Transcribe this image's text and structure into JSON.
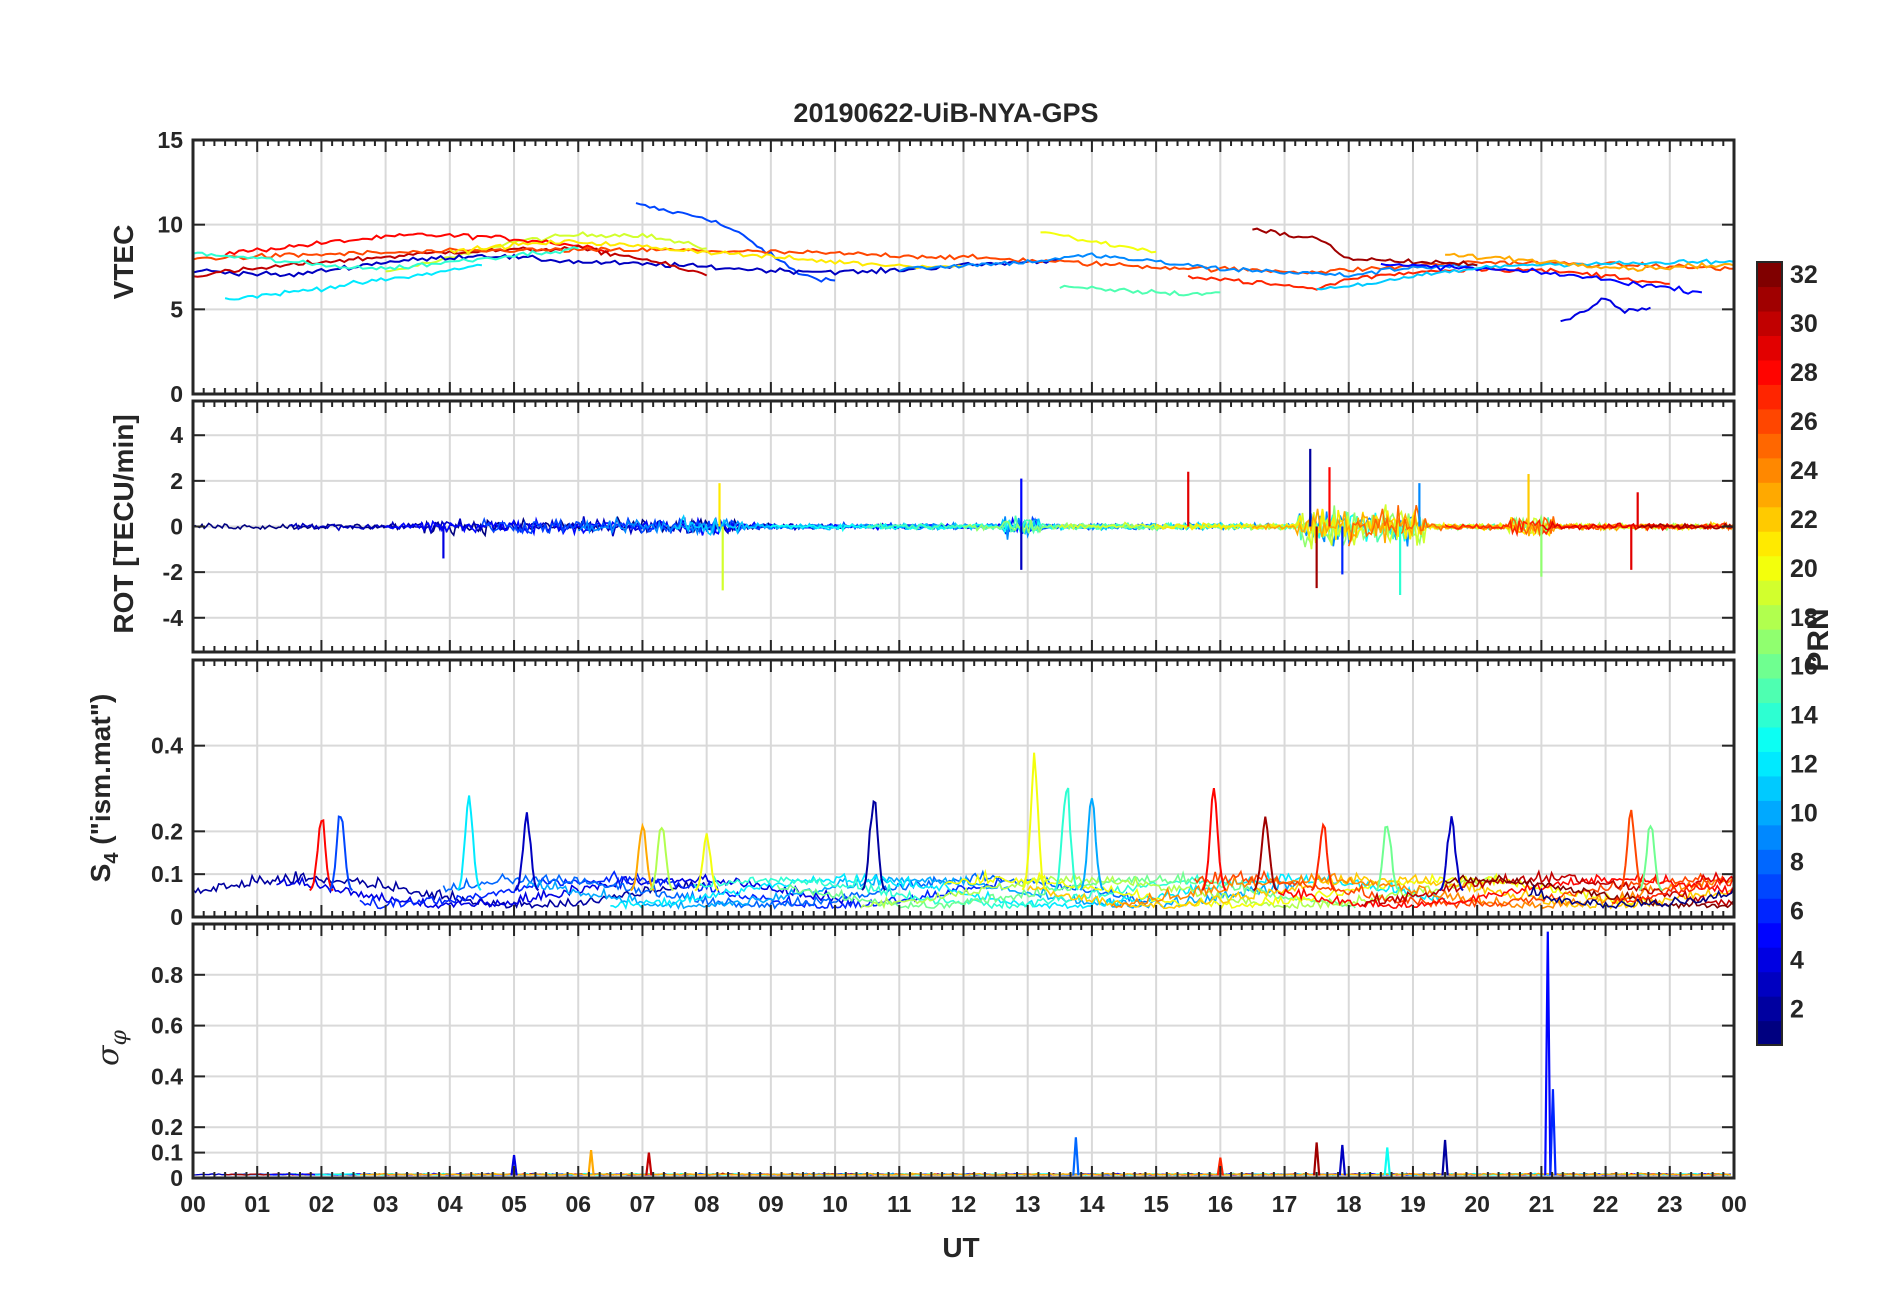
{
  "figure": {
    "title": "20190622-UiB-NYA-GPS",
    "colors": {
      "frame": "#262626",
      "grid": "#d9d9d9",
      "background": "#ffffff"
    }
  },
  "chart_data": [
    {
      "type": "line",
      "panel": "vtec",
      "ylabel": "VTEC",
      "ylim": [
        0,
        15
      ],
      "yticks": [
        0,
        5,
        10,
        15
      ],
      "xlim": [
        0,
        24
      ],
      "xlabel": "",
      "grid": true,
      "series": [
        {
          "prn": 7,
          "x": [
            6.9,
            7.4,
            8.0,
            8.5,
            9.0,
            9.5,
            10.0
          ],
          "y": [
            11.2,
            10.8,
            10.4,
            9.5,
            8.2,
            7.0,
            6.7
          ]
        },
        {
          "prn": 19,
          "x": [
            3.0,
            4.0,
            5.0,
            6.0,
            7.0,
            8.0
          ],
          "y": [
            7.2,
            8.0,
            9.0,
            9.4,
            9.4,
            8.6
          ]
        },
        {
          "prn": 28,
          "x": [
            0.5,
            1.5,
            2.5,
            3.5,
            4.5,
            5.5,
            6.5
          ],
          "y": [
            8.3,
            8.7,
            9.1,
            9.4,
            9.3,
            9.0,
            8.5
          ]
        },
        {
          "prn": 12,
          "x": [
            0.5,
            1.5,
            2.5,
            3.5,
            4.5
          ],
          "y": [
            5.6,
            6.0,
            6.5,
            7.0,
            7.6
          ]
        },
        {
          "prn": 3,
          "x": [
            0.0,
            1.5,
            3.0,
            4.5,
            6.0,
            7.5,
            9.0,
            10.5,
            12.0,
            13.5
          ],
          "y": [
            7.3,
            7.0,
            7.8,
            8.2,
            7.8,
            7.6,
            7.3,
            7.2,
            7.6,
            7.9
          ]
        },
        {
          "prn": 30,
          "x": [
            0.0,
            2.0,
            4.0,
            6.0,
            7.0,
            8.0
          ],
          "y": [
            7.0,
            7.8,
            8.4,
            8.6,
            8.0,
            7.0
          ]
        },
        {
          "prn": 26,
          "x": [
            0.0,
            2.5,
            5.0,
            7.5,
            10.0,
            12.5,
            15.0,
            17.5,
            20.0,
            22.5,
            24.0
          ],
          "y": [
            8.0,
            8.3,
            8.5,
            8.5,
            8.3,
            8.0,
            7.5,
            7.2,
            7.8,
            7.6,
            7.4
          ]
        },
        {
          "prn": 14,
          "x": [
            0.0,
            1.0,
            2.0,
            3.0,
            4.0,
            5.0,
            6.0
          ],
          "y": [
            8.3,
            8.0,
            7.6,
            7.4,
            7.8,
            8.2,
            8.6
          ]
        },
        {
          "prn": 21,
          "x": [
            4.0,
            5.0,
            6.0,
            7.0,
            8.0,
            9.0,
            10.0,
            11.0,
            12.0
          ],
          "y": [
            8.4,
            8.8,
            9.0,
            8.7,
            8.4,
            8.1,
            7.8,
            7.6,
            7.5
          ]
        },
        {
          "prn": 9,
          "x": [
            11.0,
            12.0,
            13.0,
            14.0,
            15.0,
            16.0,
            17.0,
            18.0,
            19.0,
            20.0
          ],
          "y": [
            7.4,
            7.6,
            7.8,
            8.2,
            7.8,
            7.4,
            7.2,
            7.0,
            7.5,
            7.6
          ]
        },
        {
          "prn": 15,
          "x": [
            13.5,
            14.5,
            15.5,
            16.0
          ],
          "y": [
            6.3,
            6.1,
            5.9,
            6.0
          ]
        },
        {
          "prn": 20,
          "x": [
            13.2,
            14.0,
            15.0
          ],
          "y": [
            9.6,
            9.0,
            8.4
          ]
        },
        {
          "prn": 31,
          "x": [
            16.5,
            17.0,
            17.5,
            18.0,
            19.0,
            20.0
          ],
          "y": [
            9.8,
            9.4,
            9.2,
            8.0,
            7.8,
            7.6
          ]
        },
        {
          "prn": 27,
          "x": [
            15.5,
            16.5,
            17.5,
            18.0,
            19.0,
            20.0,
            21.0,
            22.0,
            23.0
          ],
          "y": [
            7.0,
            6.6,
            6.2,
            6.8,
            7.2,
            7.4,
            7.3,
            7.0,
            6.5
          ]
        },
        {
          "prn": 5,
          "x": [
            18.5,
            19.5,
            20.5,
            21.5,
            22.5,
            23.5
          ],
          "y": [
            7.6,
            7.5,
            7.3,
            7.0,
            6.5,
            6.0
          ]
        },
        {
          "prn": 4,
          "x": [
            21.3,
            21.6,
            22.0,
            22.3,
            22.7
          ],
          "y": [
            4.3,
            4.8,
            5.6,
            4.9,
            5.1
          ]
        },
        {
          "prn": 11,
          "x": [
            17.5,
            18.5,
            19.5,
            20.5,
            21.5,
            22.5,
            23.5,
            24.0
          ],
          "y": [
            6.2,
            6.6,
            7.2,
            7.6,
            7.7,
            7.7,
            7.8,
            7.8
          ]
        },
        {
          "prn": 23,
          "x": [
            19.5,
            20.5,
            21.5,
            22.5,
            23.5,
            24.0
          ],
          "y": [
            8.2,
            8.0,
            7.7,
            7.4,
            7.6,
            7.6
          ]
        }
      ]
    },
    {
      "type": "line",
      "panel": "rot",
      "ylabel": "ROT [TECU/min]",
      "ylim": [
        -5.5,
        5.5
      ],
      "yticks": [
        -4,
        -2,
        0,
        2,
        4
      ],
      "xlim": [
        0,
        24
      ],
      "grid": true,
      "spikes": [
        {
          "x": 8.25,
          "y": -2.8,
          "prn": 19
        },
        {
          "x": 8.2,
          "y": 1.9,
          "prn": 21
        },
        {
          "x": 12.9,
          "y": 2.1,
          "prn": 5
        },
        {
          "x": 12.9,
          "y": -1.9,
          "prn": 3
        },
        {
          "x": 15.5,
          "y": 2.4,
          "prn": 29
        },
        {
          "x": 17.4,
          "y": 3.4,
          "prn": 2
        },
        {
          "x": 17.5,
          "y": -2.7,
          "prn": 31
        },
        {
          "x": 17.7,
          "y": 2.6,
          "prn": 28
        },
        {
          "x": 17.9,
          "y": -2.1,
          "prn": 6
        },
        {
          "x": 18.8,
          "y": -3.0,
          "prn": 14
        },
        {
          "x": 19.1,
          "y": 1.9,
          "prn": 9
        },
        {
          "x": 20.8,
          "y": 2.3,
          "prn": 22
        },
        {
          "x": 21.0,
          "y": -2.2,
          "prn": 17
        },
        {
          "x": 22.4,
          "y": -1.9,
          "prn": 29
        },
        {
          "x": 22.5,
          "y": 1.5,
          "prn": 29
        },
        {
          "x": 3.9,
          "y": -1.4,
          "prn": 4
        }
      ]
    },
    {
      "type": "line",
      "panel": "s4",
      "ylabel": "S4 (\"ism.mat\")",
      "ylabel_main": "S",
      "ylabel_sub": "4",
      "ylabel_tail": " (\"ism.mat\")",
      "ylim": [
        0,
        0.6
      ],
      "yticks": [
        0,
        0.1,
        0.2,
        0.4
      ],
      "ytick_labels": [
        "0",
        "0.1",
        "0.2",
        "0.4"
      ],
      "xlim": [
        0,
        24
      ],
      "grid": true,
      "peaks": [
        {
          "x": 2.0,
          "y": 0.25,
          "prn": 28
        },
        {
          "x": 2.3,
          "y": 0.27,
          "prn": 7
        },
        {
          "x": 4.3,
          "y": 0.31,
          "prn": 12
        },
        {
          "x": 5.2,
          "y": 0.25,
          "prn": 3
        },
        {
          "x": 7.0,
          "y": 0.24,
          "prn": 23
        },
        {
          "x": 7.3,
          "y": 0.24,
          "prn": 18
        },
        {
          "x": 8.0,
          "y": 0.21,
          "prn": 20
        },
        {
          "x": 10.6,
          "y": 0.3,
          "prn": 2
        },
        {
          "x": 13.1,
          "y": 0.39,
          "prn": 20
        },
        {
          "x": 13.6,
          "y": 0.34,
          "prn": 14
        },
        {
          "x": 14.0,
          "y": 0.3,
          "prn": 10
        },
        {
          "x": 15.9,
          "y": 0.32,
          "prn": 28
        },
        {
          "x": 16.7,
          "y": 0.25,
          "prn": 31
        },
        {
          "x": 18.6,
          "y": 0.24,
          "prn": 16
        },
        {
          "x": 19.6,
          "y": 0.25,
          "prn": 3
        },
        {
          "x": 22.4,
          "y": 0.26,
          "prn": 26
        },
        {
          "x": 22.7,
          "y": 0.24,
          "prn": 16
        },
        {
          "x": 17.6,
          "y": 0.23,
          "prn": 27
        }
      ]
    },
    {
      "type": "line",
      "panel": "sigma",
      "ylabel": "σφ",
      "ylabel_main": "σ",
      "ylabel_sub": "φ",
      "ylim": [
        0,
        1.0
      ],
      "yticks": [
        0,
        0.1,
        0.2,
        0.4,
        0.6,
        0.8
      ],
      "ytick_labels": [
        "0",
        "0.1",
        "0.2",
        "0.4",
        "0.6",
        "0.8"
      ],
      "xlim": [
        0,
        24
      ],
      "xlabel": "UT",
      "xticks": [
        0,
        1,
        2,
        3,
        4,
        5,
        6,
        7,
        8,
        9,
        10,
        11,
        12,
        13,
        14,
        15,
        16,
        17,
        18,
        19,
        20,
        21,
        22,
        23,
        24
      ],
      "xtick_labels": [
        "00",
        "01",
        "02",
        "03",
        "04",
        "05",
        "06",
        "07",
        "08",
        "09",
        "10",
        "11",
        "12",
        "13",
        "14",
        "15",
        "16",
        "17",
        "18",
        "19",
        "20",
        "21",
        "22",
        "23",
        "00"
      ],
      "grid": true,
      "peaks": [
        {
          "x": 21.1,
          "y": 0.97,
          "prn": 5
        },
        {
          "x": 21.18,
          "y": 0.35,
          "prn": 6
        },
        {
          "x": 13.75,
          "y": 0.16,
          "prn": 8
        },
        {
          "x": 17.5,
          "y": 0.14,
          "prn": 31
        },
        {
          "x": 17.9,
          "y": 0.13,
          "prn": 3
        },
        {
          "x": 18.6,
          "y": 0.12,
          "prn": 13
        },
        {
          "x": 19.5,
          "y": 0.15,
          "prn": 2
        },
        {
          "x": 6.2,
          "y": 0.11,
          "prn": 23
        },
        {
          "x": 7.1,
          "y": 0.1,
          "prn": 30
        },
        {
          "x": 5.0,
          "y": 0.09,
          "prn": 4
        },
        {
          "x": 16.0,
          "y": 0.08,
          "prn": 27
        }
      ]
    }
  ],
  "colorbar": {
    "label": "PRN",
    "min": 1,
    "max": 32,
    "ticks": [
      2,
      4,
      6,
      8,
      10,
      12,
      14,
      16,
      18,
      20,
      22,
      24,
      26,
      28,
      30,
      32
    ],
    "colormap": "jet"
  }
}
